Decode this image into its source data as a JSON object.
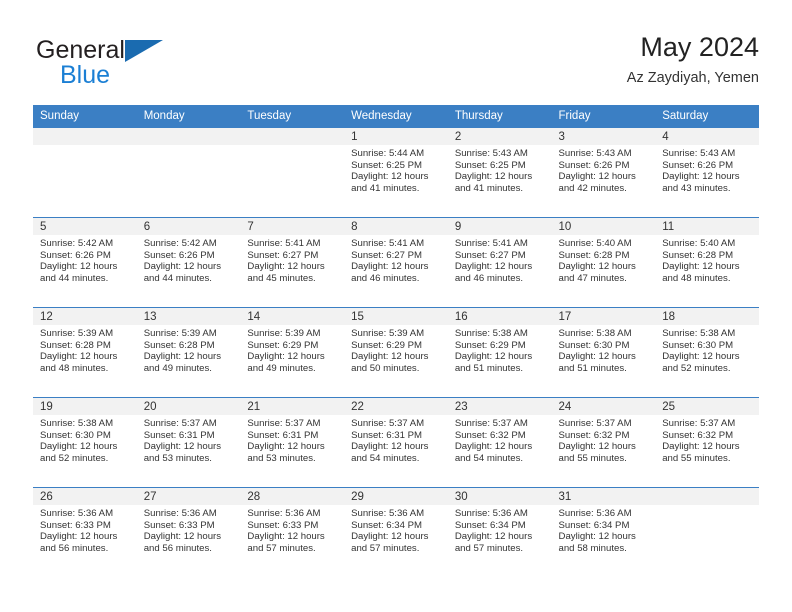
{
  "brand": {
    "name_top": "General",
    "name_bottom": "Blue",
    "triangle_icon": "blue-triangle-logo-mark",
    "color_dark": "#231f20",
    "color_blue": "#1b7fd4"
  },
  "header": {
    "title": "May 2024",
    "subtitle": "Az Zaydiyah, Yemen"
  },
  "colors": {
    "header_blue": "#3b7fc4",
    "daynum_band": "#f2f2f2",
    "text": "#333333"
  },
  "calendar": {
    "weekday_headers": [
      "Sunday",
      "Monday",
      "Tuesday",
      "Wednesday",
      "Thursday",
      "Friday",
      "Saturday"
    ],
    "weeks": [
      [
        {
          "day": "",
          "sunrise": "",
          "sunset": "",
          "daylight_1": "",
          "daylight_2": ""
        },
        {
          "day": "",
          "sunrise": "",
          "sunset": "",
          "daylight_1": "",
          "daylight_2": ""
        },
        {
          "day": "",
          "sunrise": "",
          "sunset": "",
          "daylight_1": "",
          "daylight_2": ""
        },
        {
          "day": "1",
          "sunrise": "Sunrise: 5:44 AM",
          "sunset": "Sunset: 6:25 PM",
          "daylight_1": "Daylight: 12 hours",
          "daylight_2": "and 41 minutes."
        },
        {
          "day": "2",
          "sunrise": "Sunrise: 5:43 AM",
          "sunset": "Sunset: 6:25 PM",
          "daylight_1": "Daylight: 12 hours",
          "daylight_2": "and 41 minutes."
        },
        {
          "day": "3",
          "sunrise": "Sunrise: 5:43 AM",
          "sunset": "Sunset: 6:26 PM",
          "daylight_1": "Daylight: 12 hours",
          "daylight_2": "and 42 minutes."
        },
        {
          "day": "4",
          "sunrise": "Sunrise: 5:43 AM",
          "sunset": "Sunset: 6:26 PM",
          "daylight_1": "Daylight: 12 hours",
          "daylight_2": "and 43 minutes."
        }
      ],
      [
        {
          "day": "5",
          "sunrise": "Sunrise: 5:42 AM",
          "sunset": "Sunset: 6:26 PM",
          "daylight_1": "Daylight: 12 hours",
          "daylight_2": "and 44 minutes."
        },
        {
          "day": "6",
          "sunrise": "Sunrise: 5:42 AM",
          "sunset": "Sunset: 6:26 PM",
          "daylight_1": "Daylight: 12 hours",
          "daylight_2": "and 44 minutes."
        },
        {
          "day": "7",
          "sunrise": "Sunrise: 5:41 AM",
          "sunset": "Sunset: 6:27 PM",
          "daylight_1": "Daylight: 12 hours",
          "daylight_2": "and 45 minutes."
        },
        {
          "day": "8",
          "sunrise": "Sunrise: 5:41 AM",
          "sunset": "Sunset: 6:27 PM",
          "daylight_1": "Daylight: 12 hours",
          "daylight_2": "and 46 minutes."
        },
        {
          "day": "9",
          "sunrise": "Sunrise: 5:41 AM",
          "sunset": "Sunset: 6:27 PM",
          "daylight_1": "Daylight: 12 hours",
          "daylight_2": "and 46 minutes."
        },
        {
          "day": "10",
          "sunrise": "Sunrise: 5:40 AM",
          "sunset": "Sunset: 6:28 PM",
          "daylight_1": "Daylight: 12 hours",
          "daylight_2": "and 47 minutes."
        },
        {
          "day": "11",
          "sunrise": "Sunrise: 5:40 AM",
          "sunset": "Sunset: 6:28 PM",
          "daylight_1": "Daylight: 12 hours",
          "daylight_2": "and 48 minutes."
        }
      ],
      [
        {
          "day": "12",
          "sunrise": "Sunrise: 5:39 AM",
          "sunset": "Sunset: 6:28 PM",
          "daylight_1": "Daylight: 12 hours",
          "daylight_2": "and 48 minutes."
        },
        {
          "day": "13",
          "sunrise": "Sunrise: 5:39 AM",
          "sunset": "Sunset: 6:28 PM",
          "daylight_1": "Daylight: 12 hours",
          "daylight_2": "and 49 minutes."
        },
        {
          "day": "14",
          "sunrise": "Sunrise: 5:39 AM",
          "sunset": "Sunset: 6:29 PM",
          "daylight_1": "Daylight: 12 hours",
          "daylight_2": "and 49 minutes."
        },
        {
          "day": "15",
          "sunrise": "Sunrise: 5:39 AM",
          "sunset": "Sunset: 6:29 PM",
          "daylight_1": "Daylight: 12 hours",
          "daylight_2": "and 50 minutes."
        },
        {
          "day": "16",
          "sunrise": "Sunrise: 5:38 AM",
          "sunset": "Sunset: 6:29 PM",
          "daylight_1": "Daylight: 12 hours",
          "daylight_2": "and 51 minutes."
        },
        {
          "day": "17",
          "sunrise": "Sunrise: 5:38 AM",
          "sunset": "Sunset: 6:30 PM",
          "daylight_1": "Daylight: 12 hours",
          "daylight_2": "and 51 minutes."
        },
        {
          "day": "18",
          "sunrise": "Sunrise: 5:38 AM",
          "sunset": "Sunset: 6:30 PM",
          "daylight_1": "Daylight: 12 hours",
          "daylight_2": "and 52 minutes."
        }
      ],
      [
        {
          "day": "19",
          "sunrise": "Sunrise: 5:38 AM",
          "sunset": "Sunset: 6:30 PM",
          "daylight_1": "Daylight: 12 hours",
          "daylight_2": "and 52 minutes."
        },
        {
          "day": "20",
          "sunrise": "Sunrise: 5:37 AM",
          "sunset": "Sunset: 6:31 PM",
          "daylight_1": "Daylight: 12 hours",
          "daylight_2": "and 53 minutes."
        },
        {
          "day": "21",
          "sunrise": "Sunrise: 5:37 AM",
          "sunset": "Sunset: 6:31 PM",
          "daylight_1": "Daylight: 12 hours",
          "daylight_2": "and 53 minutes."
        },
        {
          "day": "22",
          "sunrise": "Sunrise: 5:37 AM",
          "sunset": "Sunset: 6:31 PM",
          "daylight_1": "Daylight: 12 hours",
          "daylight_2": "and 54 minutes."
        },
        {
          "day": "23",
          "sunrise": "Sunrise: 5:37 AM",
          "sunset": "Sunset: 6:32 PM",
          "daylight_1": "Daylight: 12 hours",
          "daylight_2": "and 54 minutes."
        },
        {
          "day": "24",
          "sunrise": "Sunrise: 5:37 AM",
          "sunset": "Sunset: 6:32 PM",
          "daylight_1": "Daylight: 12 hours",
          "daylight_2": "and 55 minutes."
        },
        {
          "day": "25",
          "sunrise": "Sunrise: 5:37 AM",
          "sunset": "Sunset: 6:32 PM",
          "daylight_1": "Daylight: 12 hours",
          "daylight_2": "and 55 minutes."
        }
      ],
      [
        {
          "day": "26",
          "sunrise": "Sunrise: 5:36 AM",
          "sunset": "Sunset: 6:33 PM",
          "daylight_1": "Daylight: 12 hours",
          "daylight_2": "and 56 minutes."
        },
        {
          "day": "27",
          "sunrise": "Sunrise: 5:36 AM",
          "sunset": "Sunset: 6:33 PM",
          "daylight_1": "Daylight: 12 hours",
          "daylight_2": "and 56 minutes."
        },
        {
          "day": "28",
          "sunrise": "Sunrise: 5:36 AM",
          "sunset": "Sunset: 6:33 PM",
          "daylight_1": "Daylight: 12 hours",
          "daylight_2": "and 57 minutes."
        },
        {
          "day": "29",
          "sunrise": "Sunrise: 5:36 AM",
          "sunset": "Sunset: 6:34 PM",
          "daylight_1": "Daylight: 12 hours",
          "daylight_2": "and 57 minutes."
        },
        {
          "day": "30",
          "sunrise": "Sunrise: 5:36 AM",
          "sunset": "Sunset: 6:34 PM",
          "daylight_1": "Daylight: 12 hours",
          "daylight_2": "and 57 minutes."
        },
        {
          "day": "31",
          "sunrise": "Sunrise: 5:36 AM",
          "sunset": "Sunset: 6:34 PM",
          "daylight_1": "Daylight: 12 hours",
          "daylight_2": "and 58 minutes."
        },
        {
          "day": "",
          "sunrise": "",
          "sunset": "",
          "daylight_1": "",
          "daylight_2": ""
        }
      ]
    ]
  }
}
